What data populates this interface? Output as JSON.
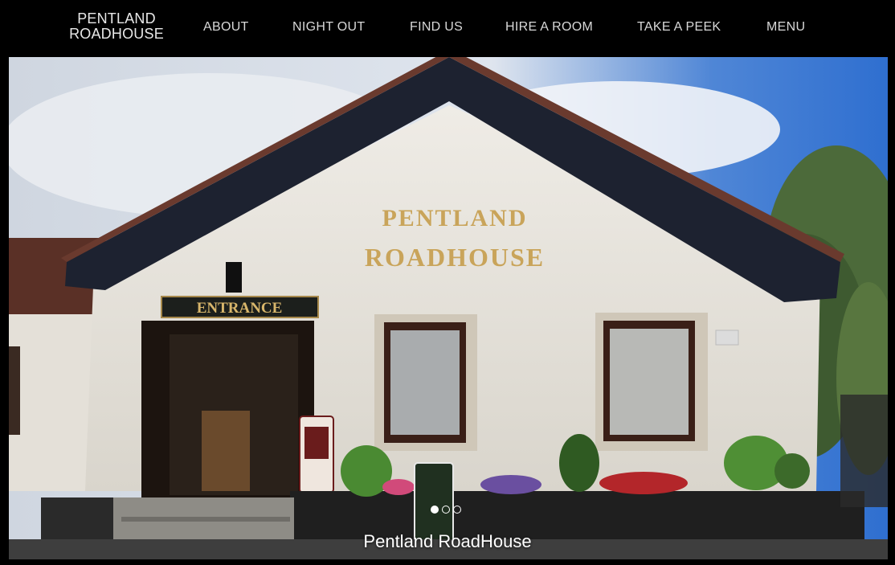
{
  "nav": {
    "brand_line1": "PENTLAND",
    "brand_line2": "ROADHOUSE",
    "items": [
      {
        "label": "ABOUT"
      },
      {
        "label": "NIGHT OUT"
      },
      {
        "label": "FIND US"
      },
      {
        "label": "HIRE A ROOM"
      },
      {
        "label": "TAKE A PEEK"
      },
      {
        "label": "MENU"
      }
    ]
  },
  "hero": {
    "building_sign_line1": "PENTLAND",
    "building_sign_line2": "ROADHOUSE",
    "entrance_sign": "ENTRANCE",
    "caption": "Pentland RoadHouse",
    "slide_count": 3,
    "active_slide": 1
  },
  "colors": {
    "nav_bg": "#000000",
    "nav_text": "#d8d8d8",
    "wall": "#e6e3db",
    "roof": "#1d2230",
    "sign_gold": "#c9a45a"
  }
}
